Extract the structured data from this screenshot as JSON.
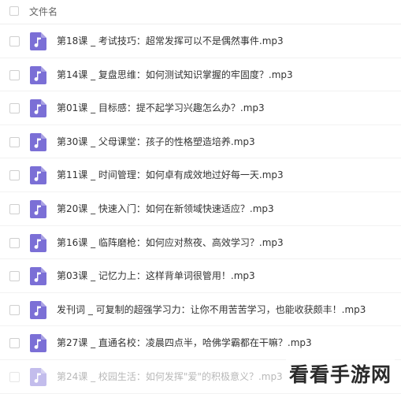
{
  "header": {
    "column_label": "文件名"
  },
  "files": [
    {
      "name": "第18课 _ 考试技巧：超常发挥可以不是偶然事件.mp3"
    },
    {
      "name": "第14课 _ 复盘思维：如何测试知识掌握的牢固度？.mp3"
    },
    {
      "name": "第01课 _ 目标感：提不起学习兴趣怎么办？.mp3"
    },
    {
      "name": "第30课 _ 父母课堂：孩子的性格塑造培养.mp3"
    },
    {
      "name": "第11课 _ 时间管理：如何卓有成效地过好每一天.mp3"
    },
    {
      "name": "第20课 _ 快速入门：如何在新领域快速适应？.mp3"
    },
    {
      "name": "第16课 _ 临阵磨枪：如何应对熬夜、高效学习？.mp3"
    },
    {
      "name": "第03课 _ 记忆力上：这样背单词很管用！.mp3"
    },
    {
      "name": "发刊词 _ 可复制的超强学习力：让你不用苦苦学习，也能收获颇丰！.mp3"
    },
    {
      "name": "第27课 _ 直通名校：凌晨四点半，哈佛学霸都在干嘛？.mp3"
    },
    {
      "name": "第24课 _ 校园生活：如何发挥\"爱\"的积极意义？.mp3"
    }
  ],
  "colors": {
    "file_icon": "#7b6fd6",
    "text": "#333333"
  },
  "watermark": {
    "text": "看看手游网"
  }
}
